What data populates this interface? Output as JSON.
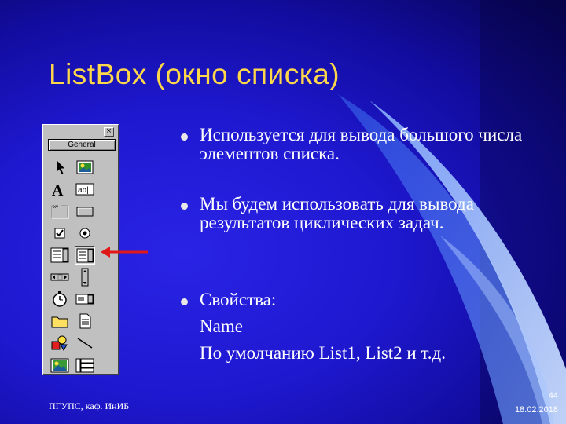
{
  "slide": {
    "title": "ListBox (окно списка)",
    "bullets": [
      "Используется для вывода большого числа элементов списка.",
      "Мы будем использовать для вывода результатов циклических задач."
    ],
    "properties": {
      "heading": "Свойства:",
      "name_line": "Name",
      "default_line": "По умолчанию List1, List2 и т.д."
    },
    "footer": {
      "org": "ПГУПС, каф. ИнИБ",
      "page_number": "44",
      "date": "18.02.2018"
    }
  },
  "toolbox": {
    "close_glyph": "×",
    "tab_label": "General",
    "tools": [
      {
        "name": "pointer-tool",
        "icon": "pointer-icon"
      },
      {
        "name": "picturebox-tool",
        "icon": "picturebox-icon"
      },
      {
        "name": "label-tool",
        "icon": "label-icon"
      },
      {
        "name": "textbox-tool",
        "icon": "textbox-icon"
      },
      {
        "name": "frame-tool",
        "icon": "frame-icon"
      },
      {
        "name": "commandbutton-tool",
        "icon": "commandbutton-icon"
      },
      {
        "name": "checkbox-tool",
        "icon": "checkbox-icon"
      },
      {
        "name": "optionbutton-tool",
        "icon": "optionbutton-icon"
      },
      {
        "name": "combobox-tool",
        "icon": "combobox-icon"
      },
      {
        "name": "listbox-tool",
        "icon": "listbox-icon",
        "selected": true
      },
      {
        "name": "hscrollbar-tool",
        "icon": "hscrollbar-icon"
      },
      {
        "name": "vscrollbar-tool",
        "icon": "vscrollbar-icon"
      },
      {
        "name": "timer-tool",
        "icon": "timer-icon"
      },
      {
        "name": "drivelistbox-tool",
        "icon": "drivelistbox-icon"
      },
      {
        "name": "dirlistbox-tool",
        "icon": "dirlistbox-icon"
      },
      {
        "name": "filelistbox-tool",
        "icon": "filelistbox-icon"
      },
      {
        "name": "shape-tool",
        "icon": "shape-icon"
      },
      {
        "name": "line-tool",
        "icon": "line-icon"
      },
      {
        "name": "image-tool",
        "icon": "image-icon"
      },
      {
        "name": "data-tool",
        "icon": "data-icon"
      }
    ]
  },
  "colors": {
    "title": "#ffd84a",
    "text": "#ffffff",
    "background": "#1d17c8",
    "arrow": "#e01818"
  }
}
